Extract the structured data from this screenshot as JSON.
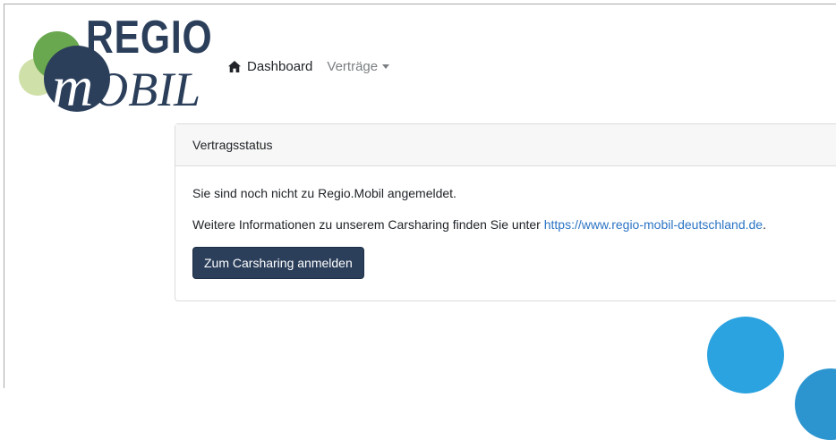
{
  "logo": {
    "regio": "REGIO",
    "mobil_m": "m",
    "mobil_rest": "OBIL"
  },
  "nav": {
    "home_label": "Dashboard",
    "vertraege_label": "Verträge"
  },
  "card": {
    "header": "Vertragsstatus",
    "line1": "Sie sind noch nicht zu Regio.Mobil angemeldet.",
    "line2_prefix": "Weitere Informationen zu unserem Carsharing finden Sie unter ",
    "link": "https://www.regio-mobil-deutschland.de",
    "line2_suffix": ".",
    "button": "Zum Carsharing anmelden"
  },
  "colors": {
    "brand_navy": "#2b3f5b",
    "brand_green": "#6aa84f",
    "light_green": "#cfe0a8",
    "accent_blue": "#2ba3e0"
  }
}
